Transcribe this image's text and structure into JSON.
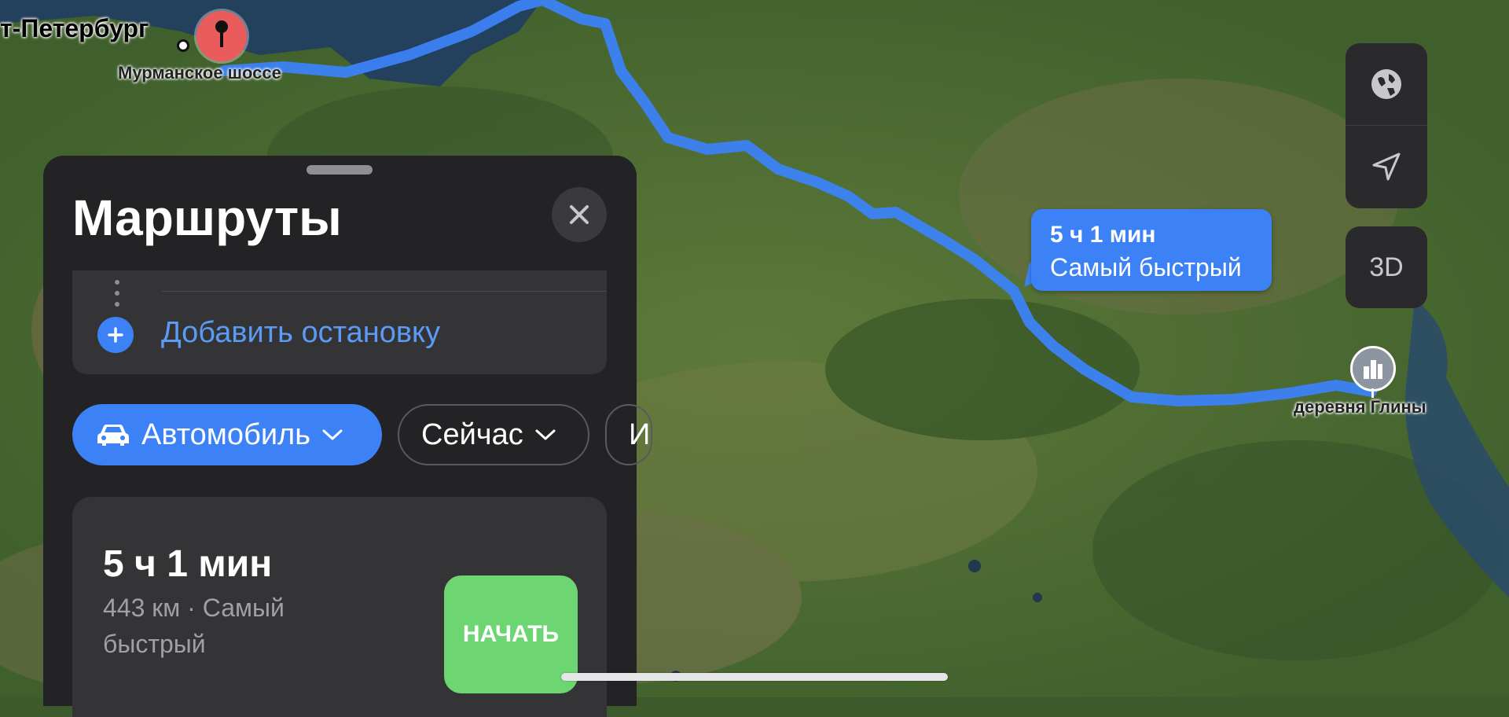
{
  "map": {
    "origin_city_label": "т-Петербург",
    "origin_road_label": "Мурманское шоссе",
    "destination_label": "деревня Глины",
    "route_callout": {
      "time": "5 ч 1 мин",
      "subtitle": "Самый быстрый"
    },
    "route_color": "#3c82f6",
    "pin_icon": "pin-icon",
    "destination_icon": "city-buildings-icon"
  },
  "controls": {
    "globe_icon": "globe-icon",
    "location_icon": "location-arrow-icon",
    "view_3d_label": "3D"
  },
  "panel": {
    "title": "Маршруты",
    "close_icon": "close-icon",
    "add_stop_label": "Добавить остановку",
    "chips": {
      "transport": {
        "label": "Автомобиль",
        "icon": "car-icon"
      },
      "time": {
        "label": "Сейчас"
      },
      "third": {
        "label": "И"
      }
    },
    "route": {
      "time": "5 ч 1 мин",
      "detail": "443 км · Самый быстрый",
      "start_label": "НАЧАТЬ",
      "start_color": "#6dd672"
    }
  }
}
